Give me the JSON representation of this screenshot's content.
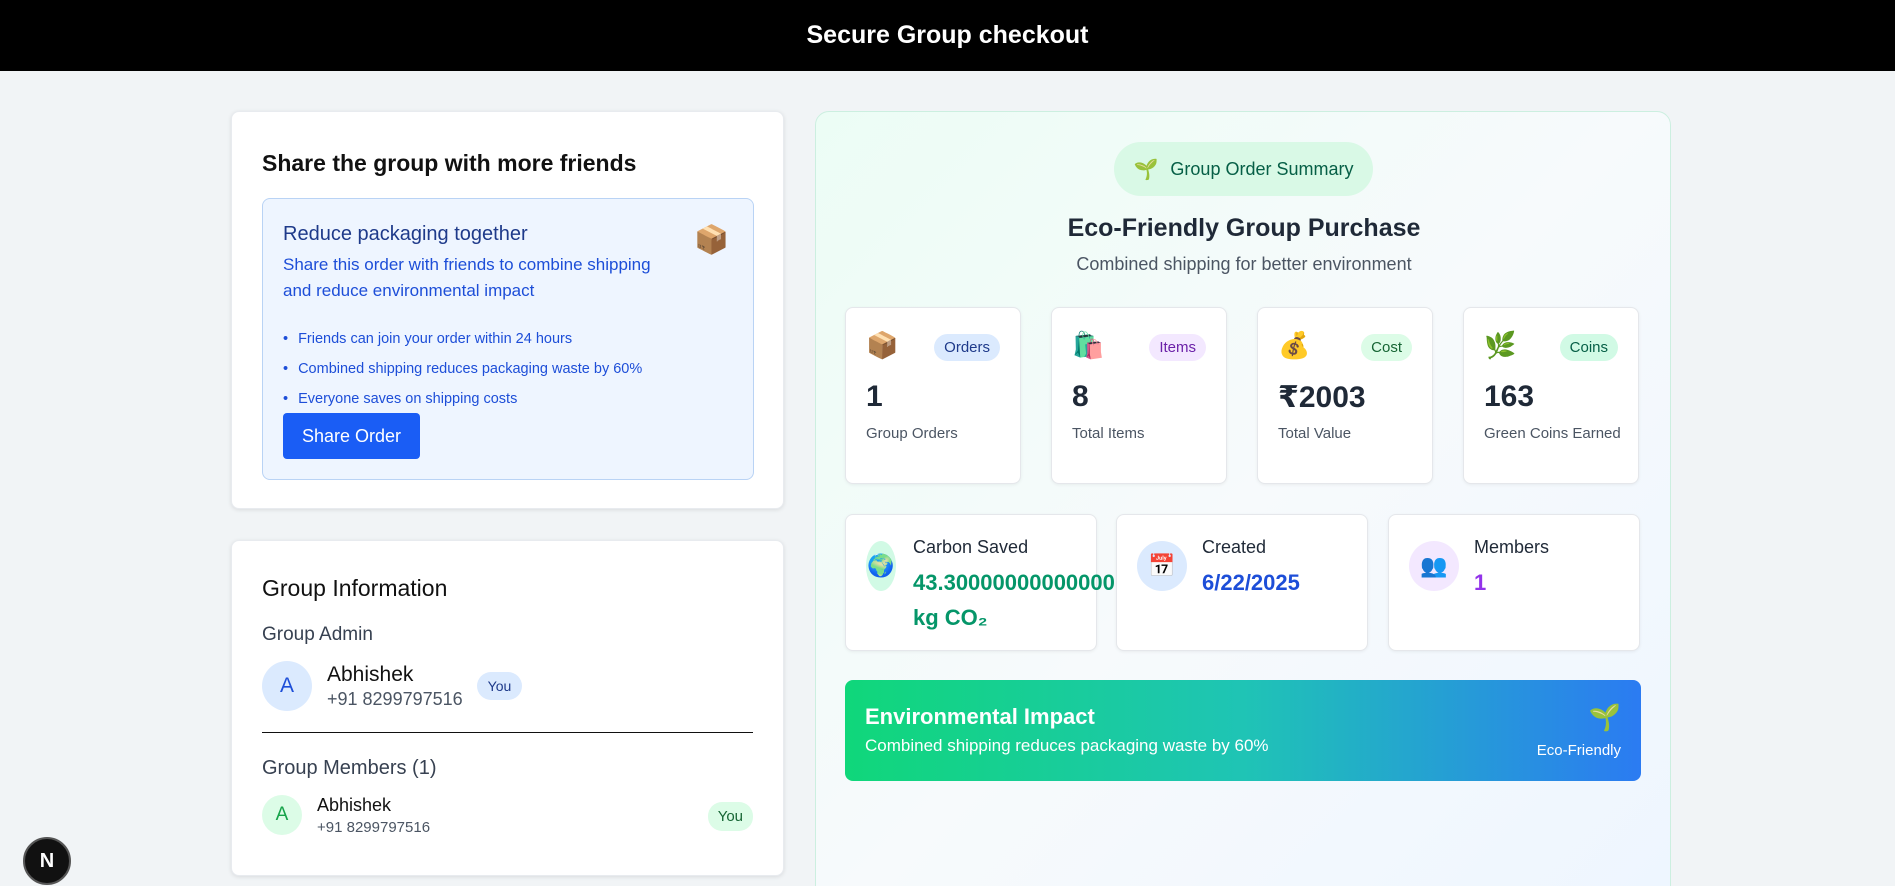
{
  "header": {
    "title": "Secure Group checkout"
  },
  "share_card": {
    "title": "Share the group with more friends",
    "box_title": "Reduce packaging together",
    "box_desc": "Share this order with friends to combine shipping and reduce environmental impact",
    "box_icon": "📦",
    "bullets": [
      "Friends can join your order within 24 hours",
      "Combined shipping reduces packaging waste by 60%",
      "Everyone saves on shipping costs"
    ],
    "bullet_char": "•",
    "button": "Share Order"
  },
  "group_info": {
    "title": "Group Information",
    "admin_label": "Group Admin",
    "admin": {
      "initial": "A",
      "name": "Abhishek",
      "phone": "+91 8299797516",
      "badge": "You"
    },
    "members_label": "Group Members (1)",
    "members": [
      {
        "initial": "A",
        "name": "Abhishek",
        "phone": "+91 8299797516",
        "badge": "You"
      }
    ]
  },
  "summary": {
    "pill_icon": "🌱",
    "pill_label": "Group Order Summary",
    "title": "Eco-Friendly Group Purchase",
    "subtitle": "Combined shipping for better environment",
    "stats": [
      {
        "icon": "📦",
        "tag": "Orders",
        "value": "1",
        "label": "Group Orders",
        "tag_bg": "#dbeafe",
        "tag_color": "#1e3a8a"
      },
      {
        "icon": "🛍️",
        "tag": "Items",
        "value": "8",
        "label": "Total Items",
        "tag_bg": "#f3e8ff",
        "tag_color": "#6b21a8"
      },
      {
        "icon": "💰",
        "tag": "Cost",
        "value": "₹2003",
        "label": "Total Value",
        "tag_bg": "#dcfce7",
        "tag_color": "#166534"
      },
      {
        "icon": "🌿",
        "tag": "Coins",
        "value": "163",
        "label": "Green Coins Earned",
        "tag_bg": "#d1fae5",
        "tag_color": "#065f46"
      }
    ],
    "details": [
      {
        "icon": "🌍",
        "label": "Carbon Saved",
        "value": "43.30000000000000",
        "value2": "kg CO₂",
        "color": "#059669",
        "icon_bg": "#d1fae5"
      },
      {
        "icon": "📅",
        "label": "Created",
        "value": "6/22/2025",
        "value2": "",
        "color": "#1d4ed8",
        "icon_bg": "#dbeafe"
      },
      {
        "icon": "👥",
        "label": "Members",
        "value": "1",
        "value2": "",
        "color": "#9333ea",
        "icon_bg": "#f3e8ff"
      }
    ],
    "impact": {
      "title": "Environmental Impact",
      "desc": "Combined shipping reduces packaging waste by 60%",
      "icon": "🌱",
      "label": "Eco-Friendly"
    }
  },
  "dev_badge": "N"
}
